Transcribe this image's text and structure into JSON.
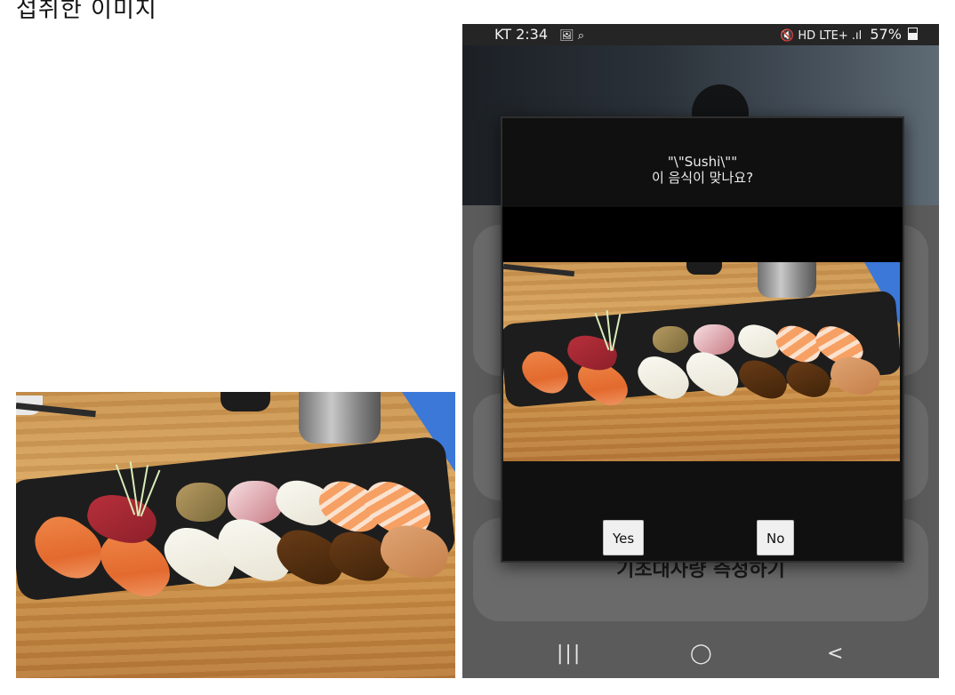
{
  "caption": "섭취한 이미지",
  "phone": {
    "status": {
      "carrier_time": "KT 2:34",
      "left_icons": "🖼 ⌕",
      "right_icons": "🔇 HD LTE+ .ıl",
      "battery": "57%"
    },
    "cards": {
      "bmr_label": "기초대사량 측정하기"
    },
    "dialog": {
      "title_line1": "\"\\\"Sushi\\\"\"",
      "title_line2": "이 음식이 맞나요?",
      "yes_label": "Yes",
      "no_label": "No"
    },
    "nav": {
      "recents": "|||",
      "home": "◯",
      "back": "<"
    }
  }
}
